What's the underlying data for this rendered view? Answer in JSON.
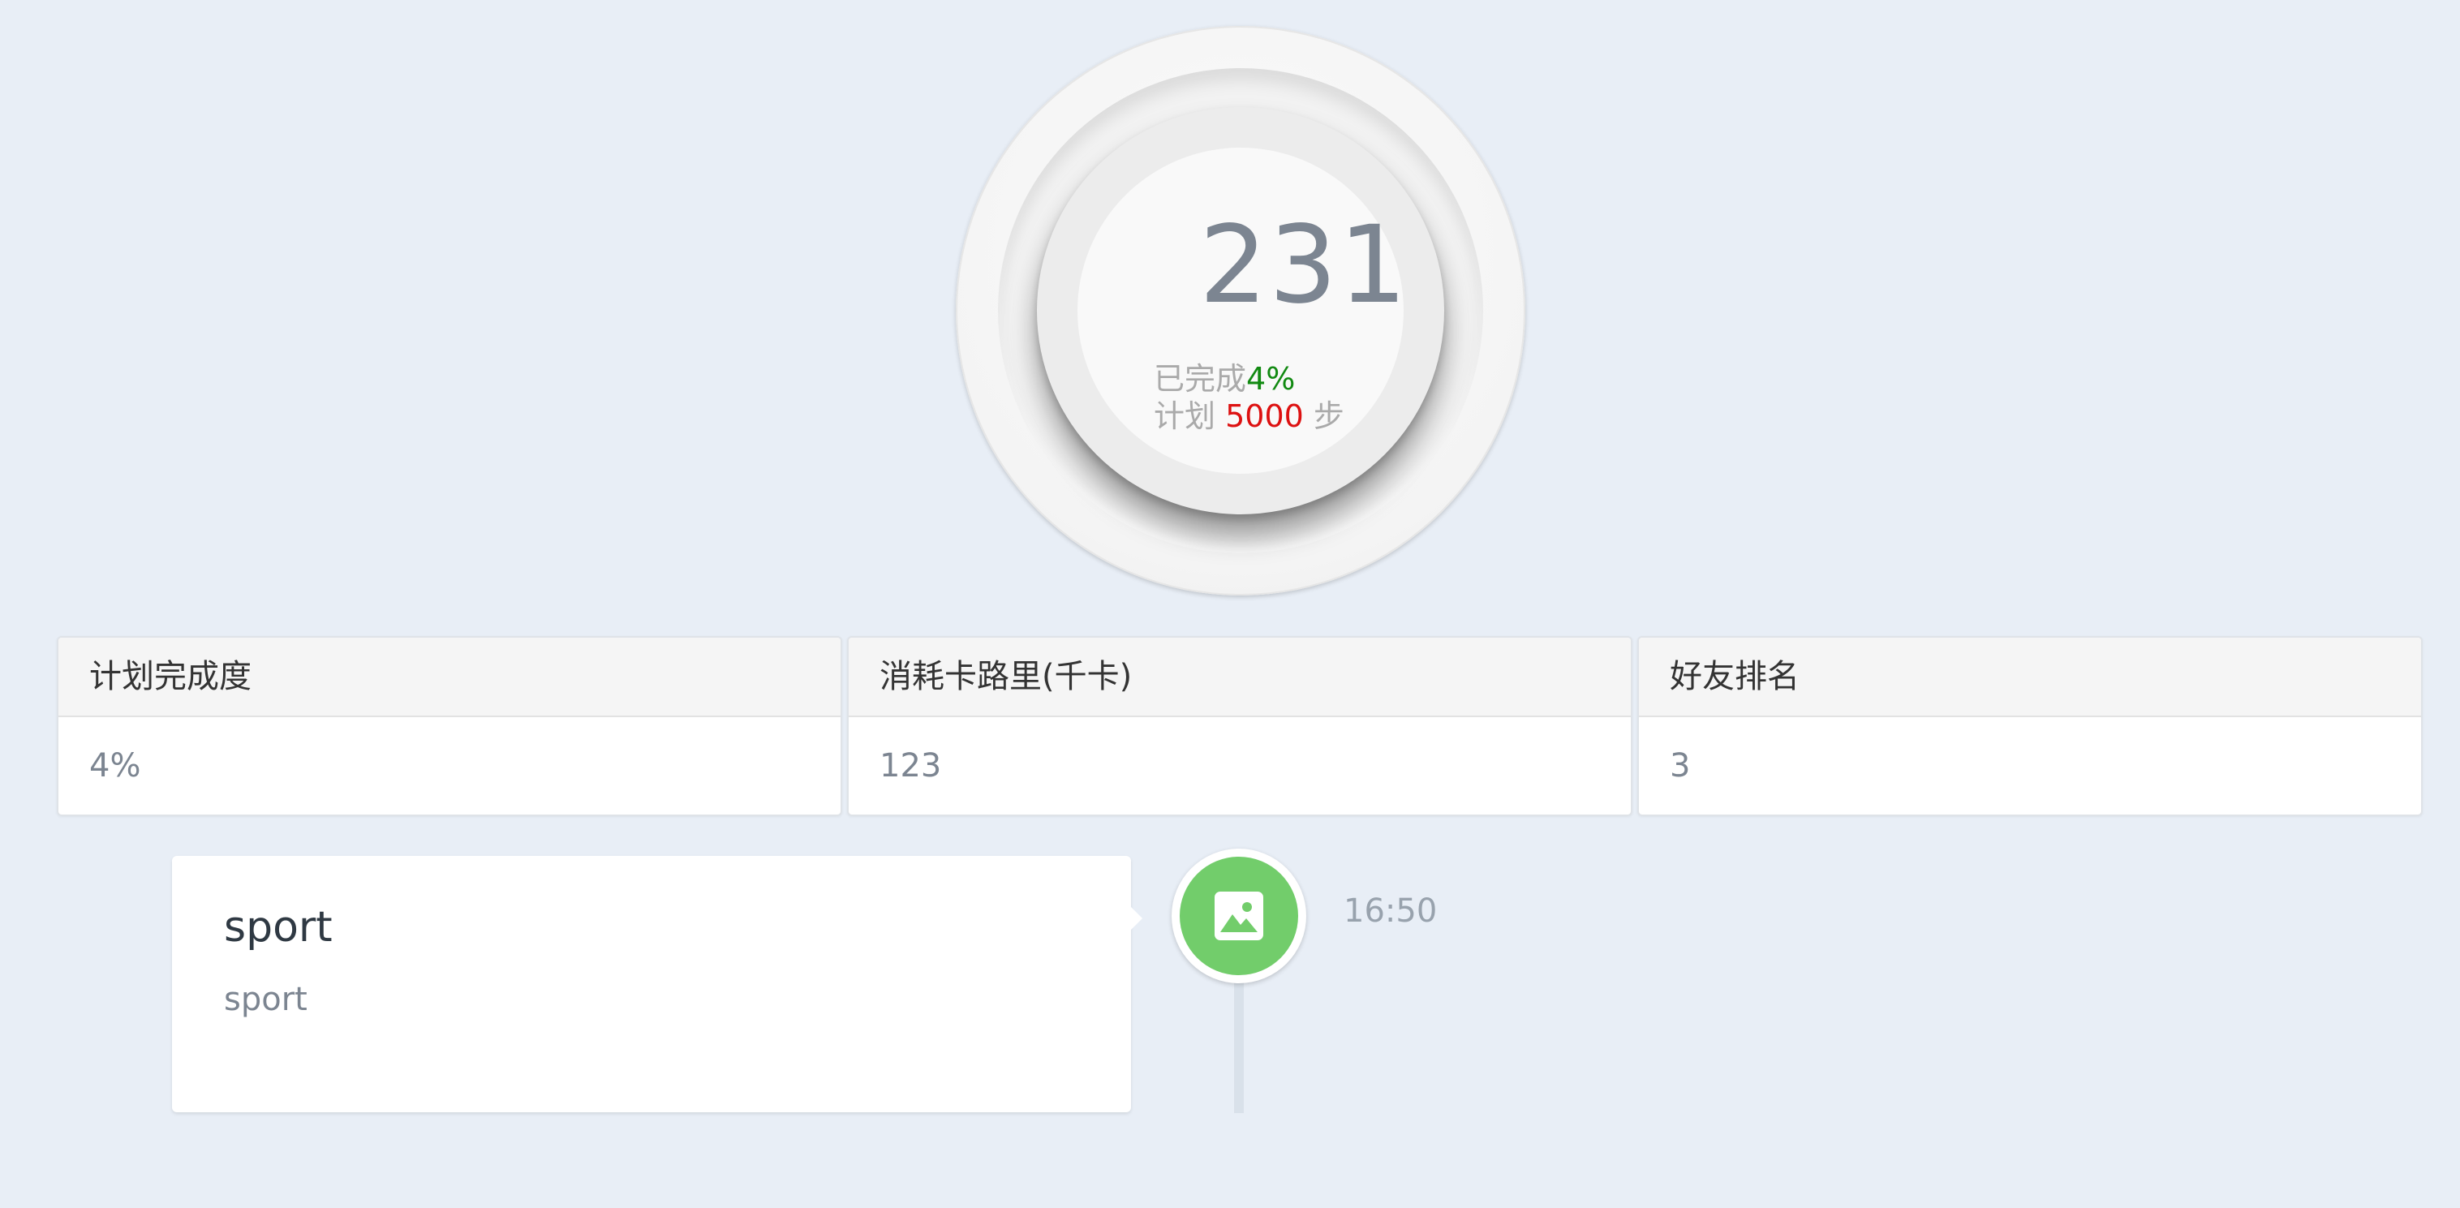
{
  "step_ring": {
    "steps": "231",
    "completed_label": "已完成",
    "completed_percent": "4%",
    "plan_label": "计划",
    "plan_steps": "5000",
    "plan_unit": "步"
  },
  "stats": [
    {
      "title": "计划完成度",
      "value": "4%"
    },
    {
      "title": "消耗卡路里(千卡)",
      "value": "123"
    },
    {
      "title": "好友排名",
      "value": "3"
    }
  ],
  "timeline": {
    "items": [
      {
        "title": "sport",
        "description": "sport",
        "time": "16:50",
        "icon": "image-icon"
      }
    ]
  },
  "colors": {
    "background": "#e8eef6",
    "percent_green": "#128a12",
    "plan_red": "#dd1111",
    "timeline_icon_green": "#72cd6b"
  }
}
